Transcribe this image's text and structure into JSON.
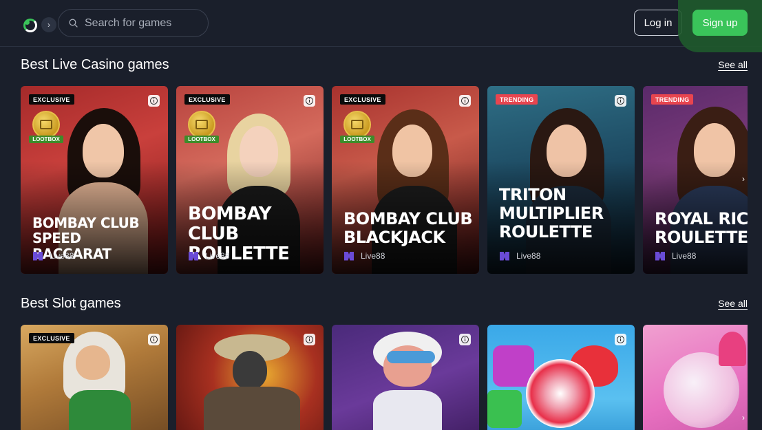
{
  "header": {
    "search_placeholder": "Search for games",
    "login_label": "Log in",
    "signup_label": "Sign up",
    "expand_icon": "›"
  },
  "sections": [
    {
      "title": "Best Live Casino games",
      "see_all": "See all",
      "cards": [
        {
          "badge": "EXCLUSIVE",
          "lootbox": "LOOTBOX",
          "title": "BOMBAY CLUB SPEED BACCARAT",
          "provider": "Live88"
        },
        {
          "badge": "EXCLUSIVE",
          "lootbox": "LOOTBOX",
          "title": "BOMBAY CLUB ROULETTE",
          "provider": "Live88"
        },
        {
          "badge": "EXCLUSIVE",
          "lootbox": "LOOTBOX",
          "title": "BOMBAY CLUB BLACKJACK",
          "provider": "Live88"
        },
        {
          "badge": "TRENDING",
          "title": "TRITON MULTIPLIER ROULETTE",
          "provider": "Live88"
        },
        {
          "badge": "TRENDING",
          "title": "ROYAL RICHES ROULETTE",
          "provider": "Live88"
        }
      ]
    },
    {
      "title": "Best Slot games",
      "see_all": "See all",
      "cards": [
        {
          "badge": "EXCLUSIVE"
        },
        {},
        {},
        {},
        {}
      ]
    }
  ],
  "icons": {
    "info": "i",
    "next": "›"
  },
  "colors": {
    "background": "#1a1f2b",
    "accent_green": "#3ac45a",
    "trending_red": "#e8454f"
  }
}
